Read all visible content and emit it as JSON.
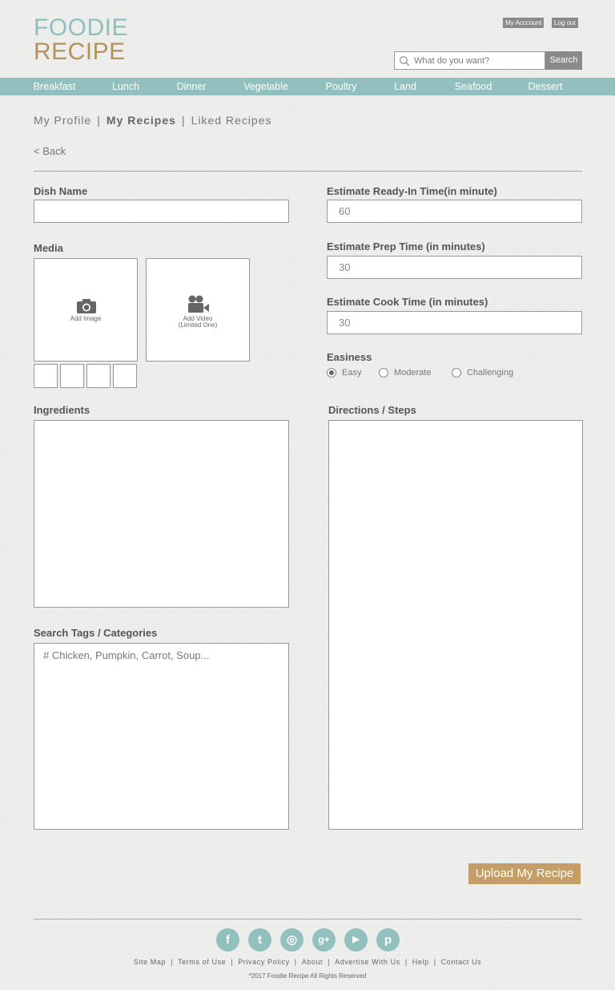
{
  "logo": {
    "line1": "FOODIE",
    "line2": "RECIPE"
  },
  "account": {
    "my_account": "My Acccount",
    "log_out": "Log out"
  },
  "search": {
    "placeholder": "What do you want?",
    "button": "Search"
  },
  "nav": {
    "items": [
      "Breakfast",
      "Lunch",
      "Dinner",
      "Vegetable",
      "Poultry",
      "Land",
      "Seafood",
      "Dessert"
    ]
  },
  "profile_tabs": {
    "my_profile": "My Profile",
    "my_recipes": "My Recipes",
    "liked_recipes": "Liked Recipes",
    "separator": "|"
  },
  "back": "< Back",
  "form": {
    "dish_name": {
      "label": "Dish Name",
      "value": ""
    },
    "ready_in": {
      "label": "Estimate Ready-In Time(in minute)",
      "value": "60"
    },
    "prep_time": {
      "label": "Estimate Prep Time (in minutes)",
      "value": "30"
    },
    "cook_time": {
      "label": "Estimate Cook Time (in minutes)",
      "value": "30"
    },
    "media": {
      "label": "Media",
      "add_image": "Add Image",
      "add_video_line1": "Add Video",
      "add_video_line2": "(Limited One)"
    },
    "easiness": {
      "label": "Easiness",
      "options": [
        "Easy",
        "Moderate",
        "Challenging"
      ],
      "selected": "Easy"
    },
    "ingredients": {
      "label": "Ingredients",
      "value": ""
    },
    "directions": {
      "label": "Directions / Steps",
      "value": ""
    },
    "tags": {
      "label": "Search Tags / Categories",
      "placeholder": "# Chicken, Pumpkin, Carrot, Soup..."
    },
    "submit": "Upload My Recipe"
  },
  "footer": {
    "social": [
      {
        "icon": "facebook-icon",
        "glyph": "f"
      },
      {
        "icon": "twitter-icon",
        "glyph": "t"
      },
      {
        "icon": "instagram-icon",
        "glyph": "◎"
      },
      {
        "icon": "google-plus-icon",
        "glyph": "g+"
      },
      {
        "icon": "youtube-icon",
        "glyph": "▶"
      },
      {
        "icon": "pinterest-icon",
        "glyph": "p"
      }
    ],
    "links": [
      "Site Map",
      "Terms of Use",
      "Privacy Policy",
      "About",
      "Advertise With Us",
      "Help",
      "Contact Us"
    ],
    "copyright": "*2017 Foodie Recipe All Rights Reserved"
  },
  "colors": {
    "teal": "#92c0be",
    "gold": "#b5925c",
    "button_gold": "#c49e66",
    "grey_button": "#8a8a8a"
  }
}
